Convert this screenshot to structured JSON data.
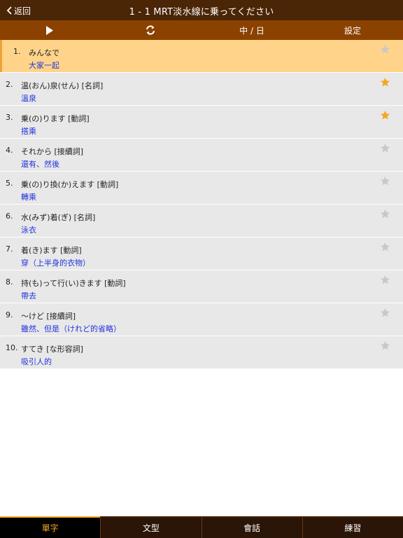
{
  "navbar": {
    "back_label": "返回",
    "title": "1 - 1 MRT淡水線に乗ってください"
  },
  "toolbar": {
    "play_icon": "play-icon",
    "refresh_icon": "refresh-icon",
    "lang_label": "中 / 日",
    "settings_label": "設定"
  },
  "colors": {
    "navbar_bg": "#4a2506",
    "toolbar_bg": "#8b4200",
    "selected_row": "#ffd48a",
    "star_active": "#f5a623",
    "star_inactive": "#c8c8c8",
    "translation_text": "#2233dd"
  },
  "vocab": [
    {
      "num": "1.",
      "jp": "みんなで",
      "zh": "大家一起",
      "starred": false,
      "selected": true
    },
    {
      "num": "2.",
      "jp": "温(おん)泉(せん)  [名詞]",
      "zh": "溫泉",
      "starred": true,
      "selected": false
    },
    {
      "num": "3.",
      "jp": "乗(の)ります  [動詞]",
      "zh": "搭乘",
      "starred": true,
      "selected": false
    },
    {
      "num": "4.",
      "jp": "それから  [接續詞]",
      "zh": "還有、然後",
      "starred": false,
      "selected": false
    },
    {
      "num": "5.",
      "jp": "乗(の)り換(か)えます  [動詞]",
      "zh": "轉乘",
      "starred": false,
      "selected": false
    },
    {
      "num": "6.",
      "jp": "水(みず)着(ぎ)  [名詞]",
      "zh": "泳衣",
      "starred": false,
      "selected": false
    },
    {
      "num": "7.",
      "jp": "着(き)ます  [動詞]",
      "zh": "穿（上半身的衣物）",
      "starred": false,
      "selected": false
    },
    {
      "num": "8.",
      "jp": "持(も)って行(い)きます  [動詞]",
      "zh": "帶去",
      "starred": false,
      "selected": false
    },
    {
      "num": "9.",
      "jp": "～けど  [接續詞]",
      "zh": "雖然、但是（けれど的省略）",
      "starred": false,
      "selected": false
    },
    {
      "num": "10.",
      "jp": "すてき  [な形容詞]",
      "zh": "吸引人的",
      "starred": false,
      "selected": false
    }
  ],
  "tabs": [
    {
      "label": "單字",
      "active": true
    },
    {
      "label": "文型",
      "active": false
    },
    {
      "label": "會話",
      "active": false
    },
    {
      "label": "練習",
      "active": false
    }
  ]
}
